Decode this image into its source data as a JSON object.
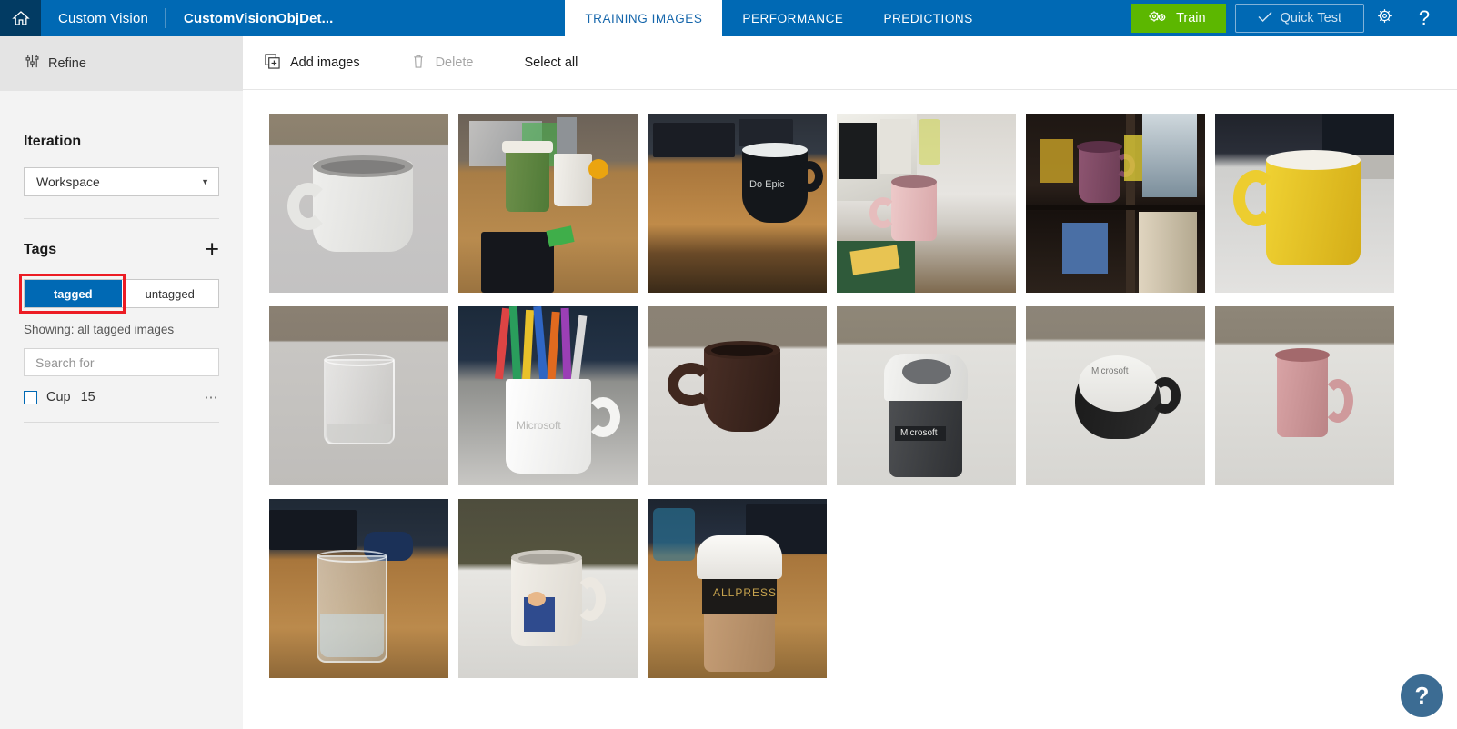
{
  "topbar": {
    "home_icon": "home-icon",
    "brand": "Custom Vision",
    "project_name": "CustomVisionObjDet...",
    "tabs": [
      {
        "label": "TRAINING IMAGES",
        "active": true
      },
      {
        "label": "PERFORMANCE",
        "active": false
      },
      {
        "label": "PREDICTIONS",
        "active": false
      }
    ],
    "train_button": {
      "label": "Train",
      "icon": "gears-icon",
      "color": "#5cb700"
    },
    "quick_test_button": {
      "label": "Quick Test",
      "icon": "check-icon"
    },
    "settings_icon": "gear-icon",
    "help_icon": "question-mark-icon",
    "bar_color": "#0069b4",
    "home_cell_color": "#023b63"
  },
  "sidebar": {
    "refine": {
      "label": "Refine",
      "icon": "sliders-icon"
    },
    "iteration": {
      "title": "Iteration",
      "selected": "Workspace",
      "caret": "▼"
    },
    "tags": {
      "title": "Tags",
      "add_icon": "plus-icon",
      "toggle": {
        "tagged_label": "tagged",
        "untagged_label": "untagged",
        "selected": "tagged",
        "highlight_color": "#ec1c24"
      },
      "showing": "Showing: all tagged images",
      "search_placeholder": "Search for",
      "search_value": "",
      "items": [
        {
          "name": "Cup",
          "count": "15",
          "checked": false,
          "menu_icon": "ellipsis-icon"
        }
      ]
    }
  },
  "toolbar": {
    "add_images": {
      "label": "Add images",
      "icon": "add-image-icon",
      "disabled": false
    },
    "delete": {
      "label": "Delete",
      "icon": "trash-icon",
      "disabled": true
    },
    "select_all": {
      "label": "Select all",
      "disabled": false
    }
  },
  "grid": {
    "images": [
      {
        "alt": "white ceramic mug on grey table"
      },
      {
        "alt": "green takeaway cup and white mug on wooden desk with orange"
      },
      {
        "alt": "black Microsoft Do Epic mug on wooden desk by keyboard"
      },
      {
        "alt": "pink mug on white bench next to microwave"
      },
      {
        "alt": "purple mug on dark bookshelf with toys"
      },
      {
        "alt": "yellow mug on white desk in front of monitor"
      },
      {
        "alt": "empty drinking glass on white table"
      },
      {
        "alt": "white Microsoft mug holding coloured pencils and pens"
      },
      {
        "alt": "dark brown mug on white table"
      },
      {
        "alt": "grey Microsoft keepcup travel mug on white table"
      },
      {
        "alt": "black and white Microsoft cup viewed from above"
      },
      {
        "alt": "pink tall mug on white table"
      },
      {
        "alt": "glass of water on wooden desk with keyboard and mouse"
      },
      {
        "alt": "white mug with cartoon figure on white table"
      },
      {
        "alt": "Allpress takeaway coffee cup with lid on wooden desk"
      }
    ]
  },
  "help_fab": {
    "icon": "question-mark-icon",
    "label": "?",
    "color": "#3c6c93"
  }
}
